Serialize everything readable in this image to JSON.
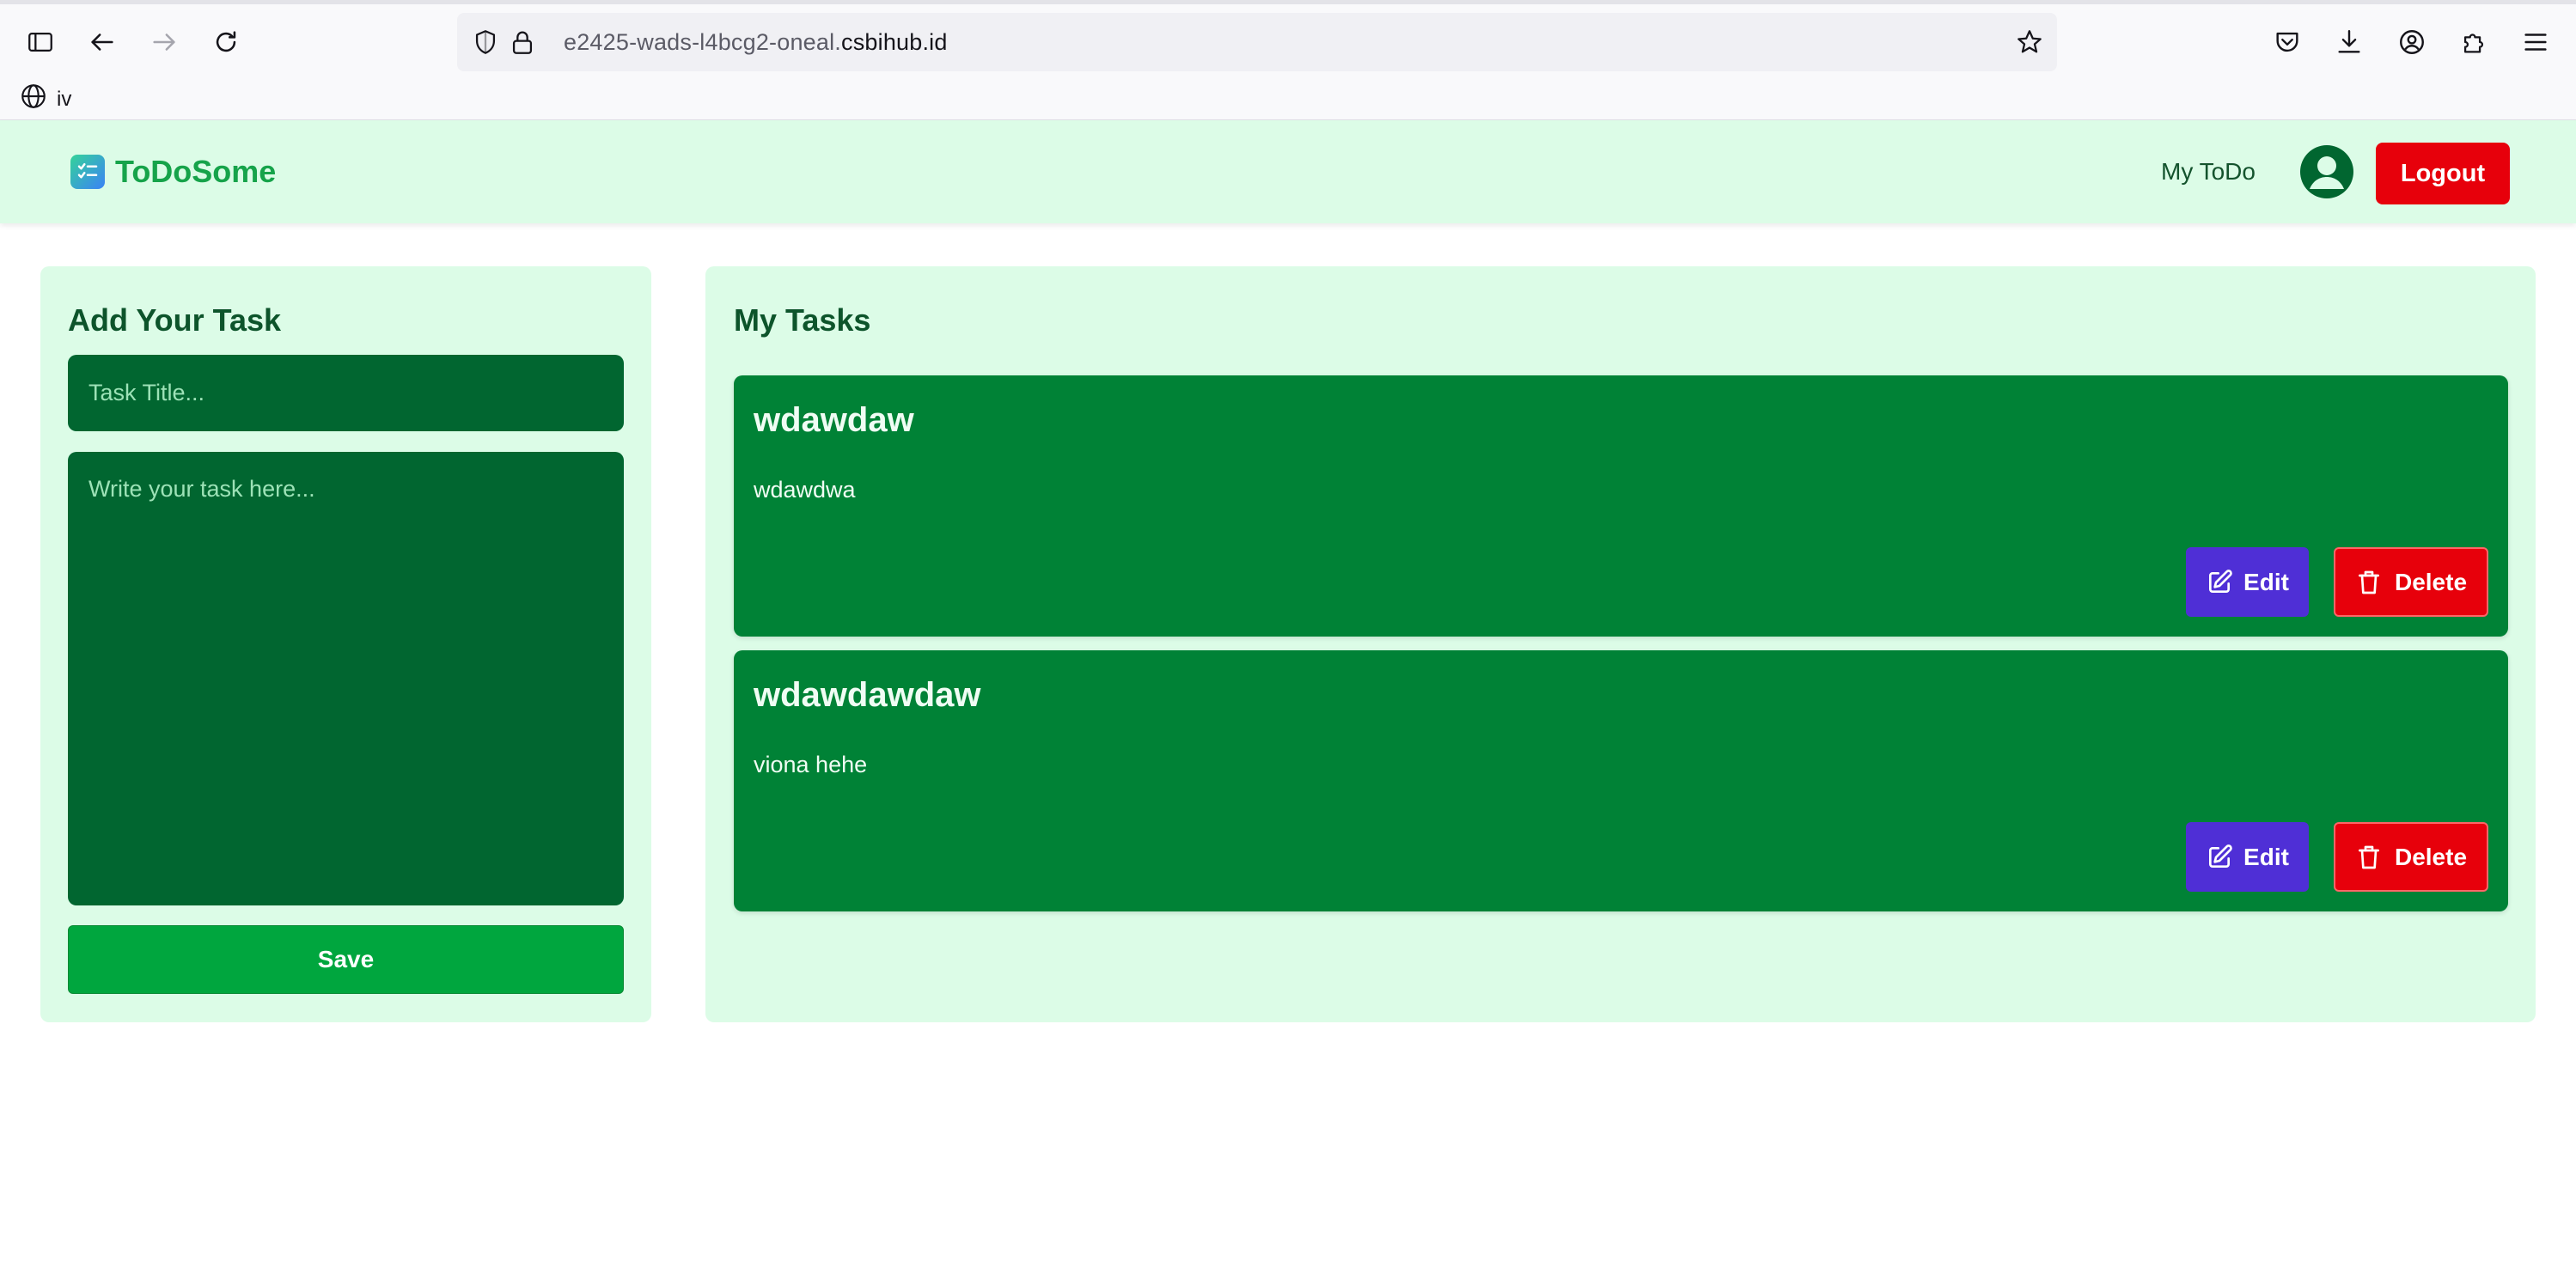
{
  "browser": {
    "url_prefix": "e2425-wads-l4bcg2-oneal.",
    "url_domain": "csbihub.id",
    "bookmark_label": "iv"
  },
  "navbar": {
    "brand": "ToDoSome",
    "link": "My ToDo",
    "logout_label": "Logout"
  },
  "add_task": {
    "heading": "Add Your Task",
    "title_placeholder": "Task Title...",
    "body_placeholder": "Write your task here...",
    "save_label": "Save"
  },
  "tasks": {
    "heading": "My Tasks",
    "edit_label": "Edit",
    "delete_label": "Delete",
    "items": [
      {
        "title": "wdawdaw",
        "description": "wdawdwa"
      },
      {
        "title": "wdawdawdaw",
        "description": "viona hehe"
      }
    ]
  },
  "colors": {
    "nav_bg": "#dcfce7",
    "brand": "#16a34a",
    "card": "#008236",
    "edit": "#4f2fd6",
    "delete": "#e7000b",
    "save": "#00a63e"
  },
  "icons": {
    "sidebar_toggle": "sidebar-icon",
    "back": "arrow-left-icon",
    "forward": "arrow-right-icon",
    "reload": "reload-icon",
    "shield": "shield-icon",
    "lock": "lock-icon",
    "bookmark_star": "star-icon",
    "pocket": "pocket-icon",
    "downloads": "download-icon",
    "account": "account-icon",
    "extensions": "puzzle-icon",
    "menu": "hamburger-icon",
    "globe": "globe-icon",
    "brand_logo": "checklist-icon",
    "avatar": "user-avatar-icon",
    "edit": "pencil-square-icon",
    "delete": "trash-icon"
  }
}
